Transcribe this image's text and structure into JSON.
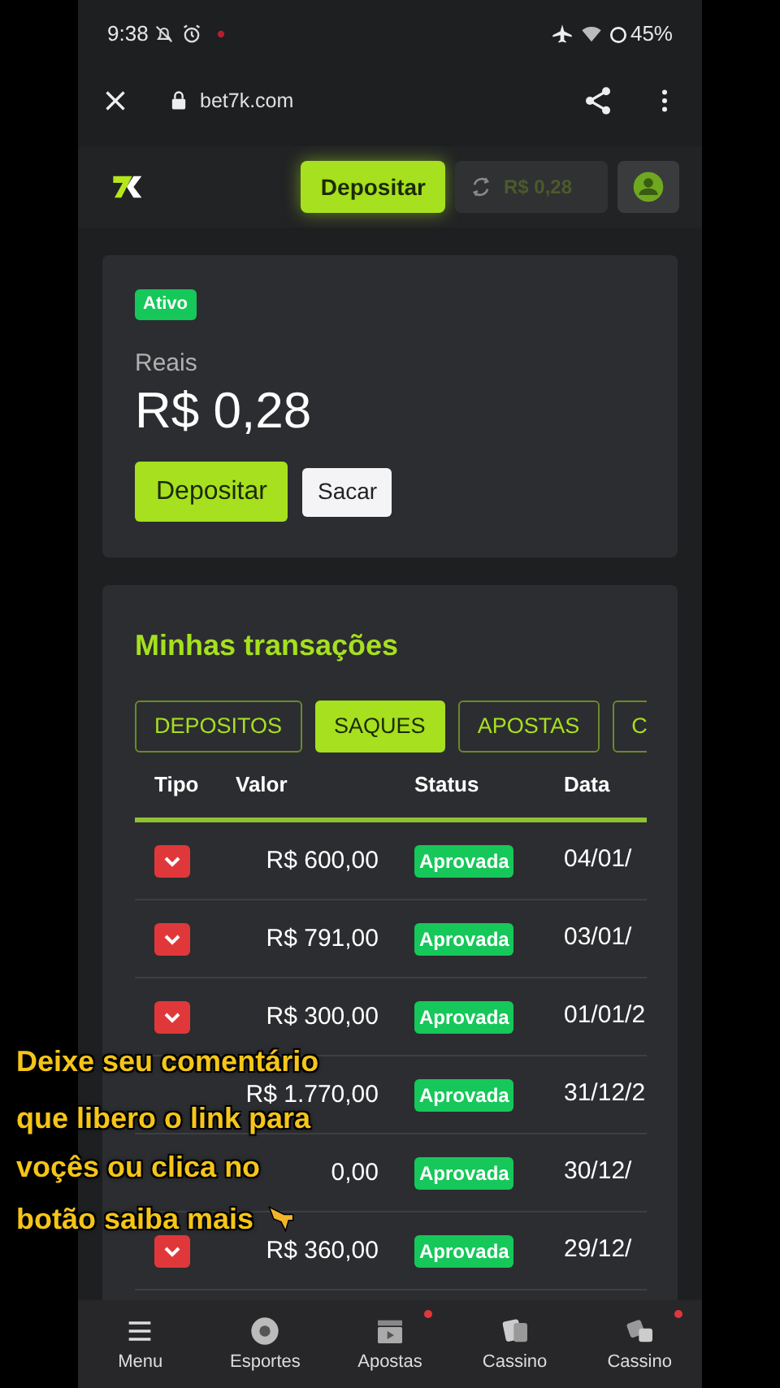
{
  "status_bar": {
    "time": "9:38",
    "battery": "45%"
  },
  "browser": {
    "url": "bet7k.com"
  },
  "header": {
    "deposit_button": "Depositar",
    "balance": "R$ 0,28"
  },
  "wallet": {
    "badge": "Ativo",
    "currency": "Reais",
    "amount": "R$ 0,28",
    "buttons": [
      {
        "label": "Depositar",
        "kind": "primary"
      },
      {
        "label": "Sacar",
        "kind": "secondary"
      }
    ]
  },
  "transactions": {
    "title": "Minhas transações",
    "tabs": [
      {
        "label": "DEPOSITOS",
        "selected": false
      },
      {
        "label": "SAQUES",
        "selected": true
      },
      {
        "label": "APOSTAS",
        "selected": false
      },
      {
        "label": "C",
        "selected": false
      }
    ],
    "columns": [
      "Tipo",
      "Valor",
      "Status",
      "Data"
    ],
    "rows": [
      {
        "value": "R$ 600,00",
        "status": "Aprovada",
        "date": "04/01/",
        "expand_button": true
      },
      {
        "value": "R$ 791,00",
        "status": "Aprovada",
        "date": "03/01/",
        "expand_button": true
      },
      {
        "value": "R$ 300,00",
        "status": "Aprovada",
        "date": "01/01/2",
        "expand_button": true
      },
      {
        "value": "R$ 1.770,00",
        "status": "Aprovada",
        "date": "31/12/2",
        "expand_button": false
      },
      {
        "value": "0,00",
        "status": "Aprovada",
        "date": "30/12/",
        "expand_button": false
      },
      {
        "value": "R$ 360,00",
        "status": "Aprovada",
        "date": "29/12/",
        "expand_button": true
      }
    ]
  },
  "bottom_nav": [
    {
      "label": "Menu",
      "dot": false
    },
    {
      "label": "Esportes",
      "dot": false
    },
    {
      "label": "Apostas",
      "dot": true
    },
    {
      "label": "Cassino",
      "dot": false
    },
    {
      "label": "Cassino",
      "dot": true
    }
  ],
  "caption": {
    "lines": [
      "Deixe seu comentário",
      "que libero o link para",
      "voçês ou clica no",
      "botão saiba mais"
    ]
  }
}
